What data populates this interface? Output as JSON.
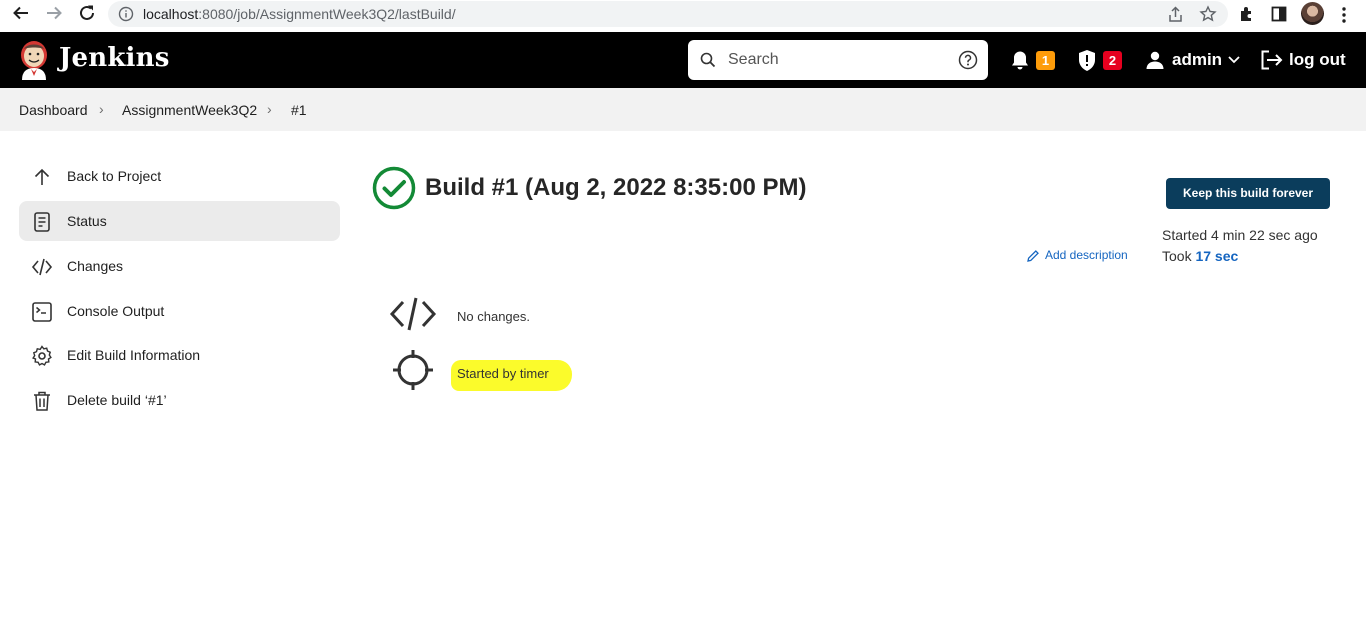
{
  "browser": {
    "url_host": "localhost",
    "url_path": ":8080/job/AssignmentWeek3Q2/lastBuild/"
  },
  "header": {
    "logo_text": "Jenkins",
    "search_placeholder": "Search",
    "notifications_count": "1",
    "security_count": "2",
    "user_name": "admin",
    "logout_label": "log out"
  },
  "breadcrumb": {
    "items": [
      "Dashboard",
      "AssignmentWeek3Q2",
      "#1"
    ]
  },
  "sidebar": {
    "items": [
      {
        "label": "Back to Project",
        "icon": "arrow-up-icon"
      },
      {
        "label": "Status",
        "icon": "document-icon"
      },
      {
        "label": "Changes",
        "icon": "code-icon"
      },
      {
        "label": "Console Output",
        "icon": "terminal-icon"
      },
      {
        "label": "Edit Build Information",
        "icon": "gear-icon"
      },
      {
        "label": "Delete build ‘#1’",
        "icon": "trash-icon"
      }
    ]
  },
  "main": {
    "title": "Build #1 (Aug 2, 2022 8:35:00 PM)",
    "keep_button": "Keep this build forever",
    "started_text": "Started 4 min 22 sec ago",
    "took_prefix": "Took ",
    "took_value": "17 sec",
    "add_description": "Add description",
    "changes_text": "No changes.",
    "cause_text": "Started by timer"
  },
  "colors": {
    "success": "#138a36",
    "keep_button_bg": "#0b3d5c",
    "link": "#1565c0",
    "highlight": "#fbfb2b",
    "badge_orange": "#fe9c0a",
    "badge_red": "#e6001f"
  }
}
